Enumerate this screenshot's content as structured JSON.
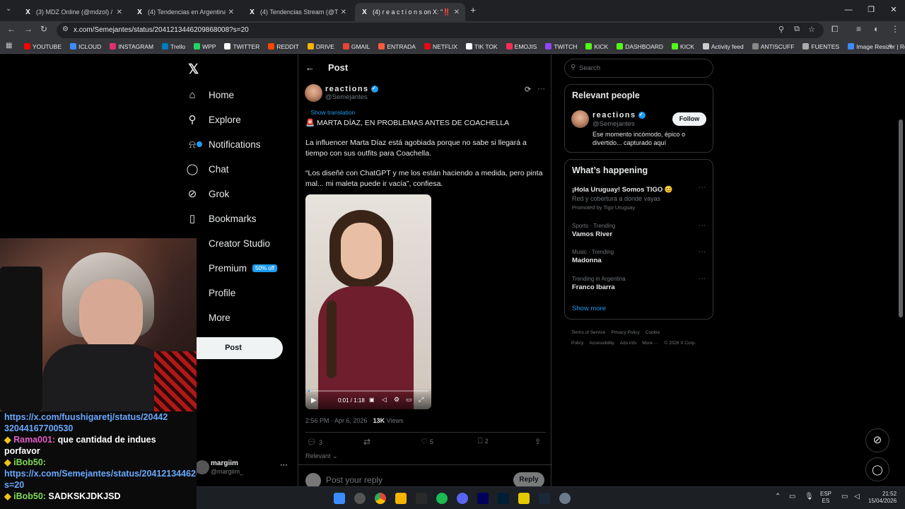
{
  "browser": {
    "tabs": [
      {
        "label": "(3) MDZ Online (@mdzol) / X",
        "active": false
      },
      {
        "label": "(4) Tendencias en Argentina (@",
        "active": false
      },
      {
        "label": "(4) Tendencias Stream (@Tnde",
        "active": false
      },
      {
        "label": "(4) r e a c t i o n s on X: \"‼️ MA",
        "active": true
      }
    ],
    "url": "x.com/Semejantes/status/2041213446209868008?s=20",
    "bookmarks": [
      {
        "label": "YOUTUBE",
        "color": "#ff0000"
      },
      {
        "label": "ICLOUD",
        "color": "#3d8cff"
      },
      {
        "label": "INSTAGRAM",
        "color": "#e1306c"
      },
      {
        "label": "Trello",
        "color": "#0079bf"
      },
      {
        "label": "WPP",
        "color": "#25d366"
      },
      {
        "label": "TWITTER",
        "color": "#ffffff"
      },
      {
        "label": "REDDIT",
        "color": "#ff4500"
      },
      {
        "label": "DRIVE",
        "color": "#f4b400"
      },
      {
        "label": "GMAIL",
        "color": "#ea4335"
      },
      {
        "label": "ENTRADA",
        "color": "#ff5a3c"
      },
      {
        "label": "NETFLIX",
        "color": "#e50914"
      },
      {
        "label": "TIK TOK",
        "color": "#ffffff"
      },
      {
        "label": "EMOJIS",
        "color": "#ff2d55"
      },
      {
        "label": "TWITCH",
        "color": "#9146ff"
      },
      {
        "label": "KICK",
        "color": "#53fc18"
      },
      {
        "label": "DASHBOARD",
        "color": "#53fc18"
      },
      {
        "label": "KICK",
        "color": "#53fc18"
      },
      {
        "label": "Activity feed",
        "color": "#cccccc"
      },
      {
        "label": "ANTISCUFF",
        "color": "#888888"
      },
      {
        "label": "FUENTES",
        "color": "#aaaaaa"
      },
      {
        "label": "Image Resizer | Resi...",
        "color": "#3d8cff"
      }
    ]
  },
  "nav": {
    "items": [
      {
        "label": "Home",
        "icon": "home-icon",
        "glyph": "⌂"
      },
      {
        "label": "Explore",
        "icon": "search-icon",
        "glyph": "⚲"
      },
      {
        "label": "Notifications",
        "icon": "bell-icon",
        "glyph": "⍾"
      },
      {
        "label": "Chat",
        "icon": "chat-icon",
        "glyph": "◯"
      },
      {
        "label": "Grok",
        "icon": "grok-icon",
        "glyph": "⊘"
      },
      {
        "label": "Bookmarks",
        "icon": "bookmark-icon",
        "glyph": "▯"
      },
      {
        "label": "Creator Studio",
        "icon": "creator-icon",
        "glyph": "✧"
      },
      {
        "label": "Premium",
        "icon": "premium-icon",
        "glyph": "X"
      },
      {
        "label": "Profile",
        "icon": "profile-icon",
        "glyph": "☺"
      },
      {
        "label": "More",
        "icon": "more-icon",
        "glyph": "⋯"
      }
    ],
    "premium_promo": "50% off",
    "post_button": "Post",
    "account": {
      "name": "margiim",
      "handle": "@margiim_"
    }
  },
  "post": {
    "header": "Post",
    "author_name": "reactions",
    "author_handle": "@Semejantes",
    "show_translation": "Show translation",
    "headline": "🚨 MARTA DÍAZ, EN PROBLEMAS ANTES DE COACHELLA",
    "body1": "La influencer Marta Díaz está agobiada porque no sabe si llegará a tiempo con sus outfits para Coachella.",
    "body2": "“Los diseñé con ChatGPT y me los están haciendo a medida, pero pinta mal... mi maleta puede ir vacía”, confiesa.",
    "video_time": "0:01 / 1:18",
    "video_progress": 0.01,
    "timestamp": "2:56 PM · Apr 6, 2026",
    "views_count": "13K",
    "views_label": "Views",
    "replies": "3",
    "likes": "5",
    "bookmarks": "2",
    "sort": "Relevant",
    "reply_placeholder": "Post your reply",
    "reply_button": "Reply"
  },
  "sidebar": {
    "search_placeholder": "Search",
    "relevant_title": "Relevant people",
    "person": {
      "name": "reactions",
      "handle": "@Semejantes",
      "bio": "Ese momento incómodo, épico o divertido... capturado aquí",
      "follow": "Follow"
    },
    "happening_title": "What’s happening",
    "trends": [
      {
        "meta": "",
        "title": "¡Hola Uruguay! Somos TIGO 😊",
        "sub": "Red y cobertura a donde vayas",
        "promo": "Promoted by Tigo Uruguay"
      },
      {
        "meta": "Sports · Trending",
        "title": "Vamos River",
        "sub": "",
        "promo": ""
      },
      {
        "meta": "Music · Trending",
        "title": "Madonna",
        "sub": "",
        "promo": ""
      },
      {
        "meta": "Trending in Argentina",
        "title": "Franco Ibarra",
        "sub": "",
        "promo": ""
      }
    ],
    "show_more": "Show more",
    "footer": [
      "Terms of Service",
      "Privacy Policy",
      "Cookie Policy",
      "Accessibility",
      "Ads info",
      "More ···",
      "© 2026 X Corp."
    ]
  },
  "chat": {
    "messages": [
      {
        "user": "",
        "text": "https://x.com/fuushigaretj/status/20442",
        "type": "link"
      },
      {
        "user": "",
        "text": "32044167700530",
        "type": "link"
      },
      {
        "user": "Rama001:",
        "text": "que cantidad de indues porfavor",
        "type": "msg"
      },
      {
        "user": "iBob50:",
        "text": "https://x.com/Semejantes/status/2041213446209868008?s=20",
        "type": "link"
      },
      {
        "user": "iBob50:",
        "text": "SADKSKJDKJSD",
        "type": "msg"
      }
    ]
  },
  "taskbar": {
    "lang": "ESP",
    "lang2": "ES",
    "time": "21:52",
    "date": "15/04/2026"
  }
}
